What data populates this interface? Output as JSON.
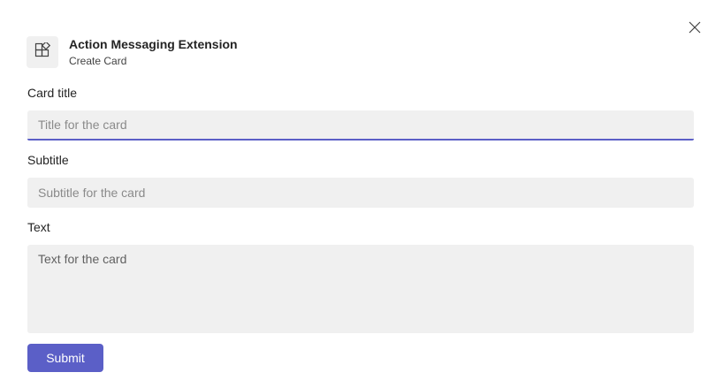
{
  "header": {
    "app_title": "Action Messaging Extension",
    "app_subtitle": "Create Card",
    "app_icon": "apps-add-icon",
    "close_icon": "close-icon"
  },
  "form": {
    "title_label": "Card title",
    "title_placeholder": "Title for the card",
    "title_value": "",
    "subtitle_label": "Subtitle",
    "subtitle_placeholder": "Subtitle for the card",
    "subtitle_value": "",
    "text_label": "Text",
    "text_placeholder": "Text for the card",
    "text_value": "",
    "submit_label": "Submit"
  },
  "colors": {
    "accent": "#5b5fc7",
    "field_background": "#f0f0f0"
  }
}
